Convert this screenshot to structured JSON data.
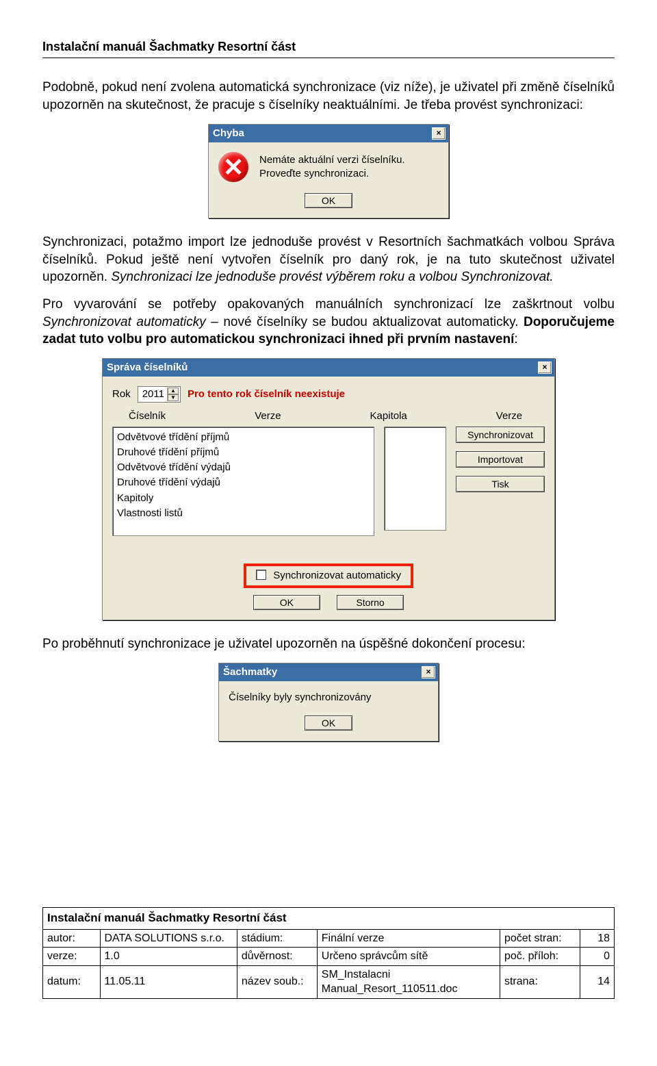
{
  "header": "Instalační manuál Šachmatky Resortní část",
  "p1": "Podobně, pokud není zvolena automatická synchronizace (viz níže), je uživatel při změně číselníků upozorněn na skutečnost, že pracuje s číselníky neaktuálními. Je třeba provést synchronizaci:",
  "err": {
    "title": "Chyba",
    "line1": "Nemáte aktuální verzi číselníku.",
    "line2": "Proveďte synchronizaci.",
    "ok": "OK"
  },
  "p2a": "Synchronizaci, potažmo import lze jednoduše provést v Resortních šachmatkách volbou Správa číselníků. Pokud ještě není vytvořen číselník pro daný rok, je na tuto skutečnost uživatel upozorněn. ",
  "p2b": "Synchronizaci lze jednoduše provést výběrem roku a volbou Synchronizovat.",
  "p3a": "Pro vyvarování se potřeby opakovaných manuálních synchronizací lze zaškrtnout volbu ",
  "p3b": "Synchronizovat automaticky",
  "p3c": " – nové číselníky se budou aktualizovat automaticky. ",
  "p3d": "Doporučujeme zadat tuto volbu pro automatickou synchronizaci ihned při prvním nastavení",
  "p3e": ":",
  "dlg": {
    "title": "Správa číselníků",
    "rokLabel": "Rok",
    "rokValue": "2011",
    "warn": "Pro tento rok číselník neexistuje",
    "col1": "Číselník",
    "col2": "Verze",
    "col3": "Kapitola",
    "col4": "Verze",
    "items": [
      "Odvětvové třídění příjmů",
      "Druhové třídění příjmů",
      "Odvětvové třídění výdajů",
      "Druhové třídění výdajů",
      "Kapitoly",
      "Vlastnosti listů"
    ],
    "btnSync": "Synchronizovat",
    "btnImport": "Importovat",
    "btnTisk": "Tisk",
    "auto": "Synchronizovat automaticky",
    "ok": "OK",
    "storno": "Storno"
  },
  "p4": "Po proběhnutí synchronizace je uživatel upozorněn na úspěšné dokončení procesu:",
  "done": {
    "title": "Šachmatky",
    "msg": "Číselníky byly synchronizovány",
    "ok": "OK"
  },
  "footer": {
    "title": "Instalační manuál Šachmatky Resortní část",
    "r1": [
      "autor:",
      "DATA SOLUTIONS s.r.o.",
      "stádium:",
      "Finální verze",
      "počet stran:",
      "18"
    ],
    "r2": [
      "verze:",
      "1.0",
      "důvěrnost:",
      "Určeno správcům sítě",
      "poč. příloh:",
      "0"
    ],
    "r3": [
      "datum:",
      "11.05.11",
      "název soub.:",
      "SM_Instalacni Manual_Resort_110511.doc",
      "strana:",
      "14"
    ]
  }
}
